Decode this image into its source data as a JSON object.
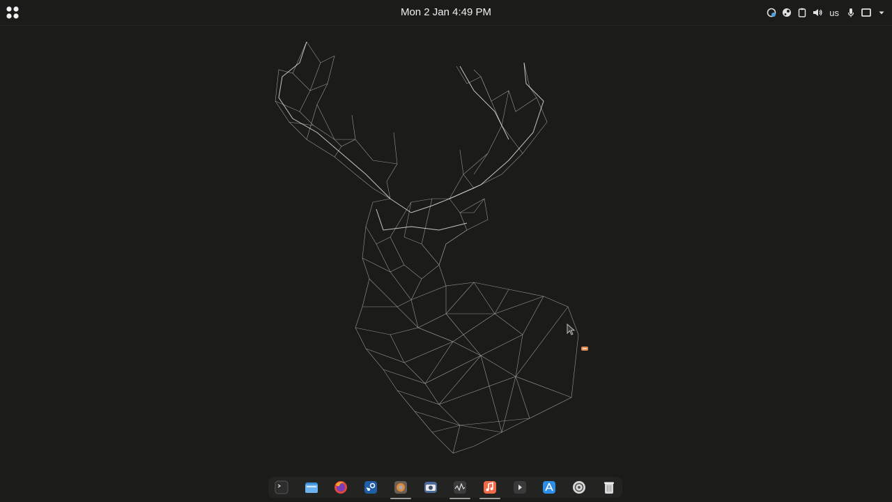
{
  "topbar": {
    "clock_text": "Mon 2 Jan  4:49 PM",
    "keyboard_layout": "us",
    "tray_icons": [
      "vpn-icon",
      "steam-icon",
      "clipboard-icon",
      "volume-icon",
      "microphone-icon",
      "screen-icon",
      "chevron-down-icon"
    ]
  },
  "dock": {
    "items": [
      {
        "name": "terminal",
        "running": false
      },
      {
        "name": "files",
        "running": false
      },
      {
        "name": "firefox",
        "running": false
      },
      {
        "name": "steam",
        "running": false
      },
      {
        "name": "browser",
        "running": true
      },
      {
        "name": "camera",
        "running": false
      },
      {
        "name": "system-monitor",
        "running": true
      },
      {
        "name": "music",
        "running": true
      },
      {
        "name": "video-player",
        "running": false
      },
      {
        "name": "app-store",
        "running": false
      },
      {
        "name": "settings",
        "running": false
      },
      {
        "name": "trash",
        "running": false
      }
    ]
  },
  "colors": {
    "background": "#1b1b18",
    "dock": "#232321",
    "wallpaper_lines": "#ffffff"
  }
}
